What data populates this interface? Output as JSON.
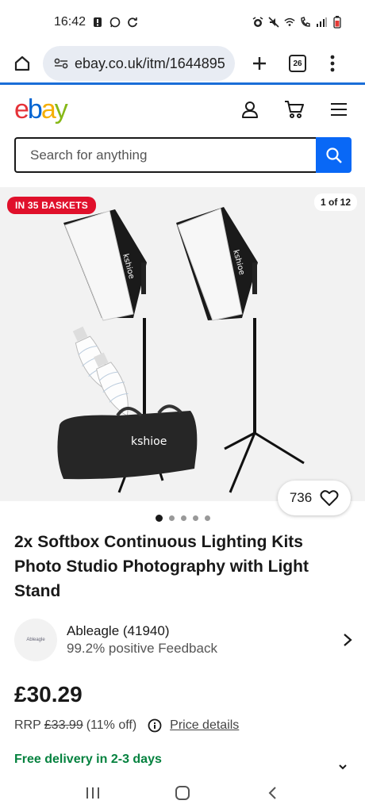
{
  "status_bar": {
    "time": "16:42"
  },
  "browser": {
    "url": "ebay.co.uk/itm/1644895",
    "tab_count": "26"
  },
  "header": {
    "logo_letters": [
      "e",
      "b",
      "a",
      "y"
    ],
    "logo_colors": [
      "#e53238",
      "#0064d2",
      "#f5af02",
      "#86b817"
    ]
  },
  "search": {
    "placeholder": "Search for anything"
  },
  "gallery": {
    "baskets_badge": "IN 35 BASKETS",
    "image_counter": "1 of 12",
    "watch_count": "736",
    "dot_count": 5,
    "active_dot": 0,
    "brand_on_product": "kshioe"
  },
  "product": {
    "title": "2x Softbox Continuous Lighting Kits Photo Studio Photography with Light Stand"
  },
  "seller": {
    "avatar_text": "Ableagle",
    "name": "Ableagle (41940)",
    "feedback": "99.2% positive Feedback"
  },
  "pricing": {
    "price": "£30.29",
    "rrp_label": "RRP",
    "rrp_value": "£33.99",
    "discount": "(11% off)",
    "details_link": "Price details"
  },
  "delivery": {
    "text": "Free delivery in 2-3 days"
  },
  "colors": {
    "accent_blue": "#0968f6",
    "badge_red": "#e0102b",
    "delivery_green": "#05823f"
  }
}
